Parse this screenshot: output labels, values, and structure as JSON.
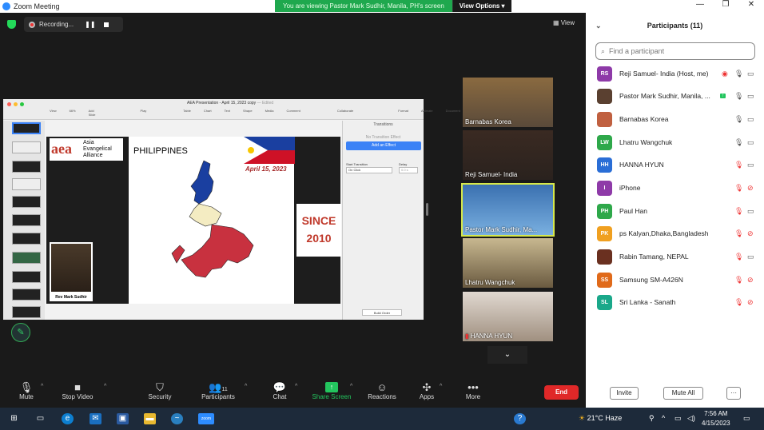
{
  "window": {
    "title": "Zoom Meeting",
    "controls": [
      "—",
      "❐",
      "✕"
    ]
  },
  "banner": {
    "message": "You are viewing Pastor Mark Sudhir, Manila, PH's screen",
    "button": "View Options"
  },
  "recording": {
    "label": "Recording..."
  },
  "view_button": "View",
  "shared_screen": {
    "app_title": "AEA Presentation - April 15, 2023 copy",
    "edited": "— Edited",
    "tools": [
      "View",
      "Zoom",
      "Add Slide",
      "Play",
      "Table",
      "Chart",
      "Text",
      "Shape",
      "Media",
      "Comment",
      "Collaborate",
      "Format",
      "Animate",
      "Document"
    ],
    "zoom_level": "66%",
    "slide": {
      "logo_text": "aea",
      "org_line1": "Asia",
      "org_line2": "Evangelical",
      "org_line3": "Alliance",
      "country": "PHILIPPINES",
      "date": "April 15, 2023",
      "since_line1": "SINCE",
      "since_line2": "2010",
      "presenter": "Rev Mark Sudhir"
    },
    "side_panel": {
      "header": "Transitions",
      "no_effect": "No Transition Effect",
      "add_effect": "Add an Effect",
      "start_label": "Start Transition",
      "start_value": "On Click",
      "delay_label": "Delay",
      "delay_value": "0.0 s",
      "build_order": "Build Order"
    }
  },
  "videos": [
    {
      "name": "Barnabas Korea"
    },
    {
      "name": "Reji Samuel- India"
    },
    {
      "name": "Pastor Mark Sudhir, Ma..."
    },
    {
      "name": "Lhatru Wangchuk"
    },
    {
      "name": "HANNA HYUN"
    }
  ],
  "toolbar": {
    "mute": "Mute",
    "stop_video": "Stop Video",
    "security": "Security",
    "participants": "Participants",
    "participants_count": "11",
    "chat": "Chat",
    "share_screen": "Share Screen",
    "reactions": "Reactions",
    "apps": "Apps",
    "more": "More",
    "end": "End"
  },
  "panel": {
    "title": "Participants (11)",
    "search_placeholder": "Find a participant",
    "invite": "Invite",
    "mute_all": "Mute All",
    "more": "···",
    "participants": [
      {
        "initials": "RS",
        "name": "Reji Samuel- India (Host, me)",
        "color": "#8e3aa8"
      },
      {
        "initials": "",
        "name": "Pastor Mark Sudhir, Manila, ...",
        "color": "#5a4030"
      },
      {
        "initials": "",
        "name": "Barnabas Korea",
        "color": "#c06040"
      },
      {
        "initials": "LW",
        "name": "Lhatru Wangchuk",
        "color": "#2ea84a"
      },
      {
        "initials": "HH",
        "name": "HANNA HYUN",
        "color": "#2a6ed6"
      },
      {
        "initials": "I",
        "name": "iPhone",
        "color": "#8e3aa8"
      },
      {
        "initials": "PH",
        "name": "Paul Han",
        "color": "#2ea84a"
      },
      {
        "initials": "PK",
        "name": "ps Kalyan,Dhaka,Bangladesh",
        "color": "#f0a020"
      },
      {
        "initials": "",
        "name": "Rabin Tamang, NEPAL",
        "color": "#6a3020"
      },
      {
        "initials": "SS",
        "name": "Samsung SM-A426N",
        "color": "#e06a1a"
      },
      {
        "initials": "SL",
        "name": "Sri Lanka - Sanath",
        "color": "#1aa88a"
      }
    ]
  },
  "taskbar": {
    "weather": "21°C  Haze",
    "time": "7:56 AM",
    "date": "4/15/2023"
  }
}
